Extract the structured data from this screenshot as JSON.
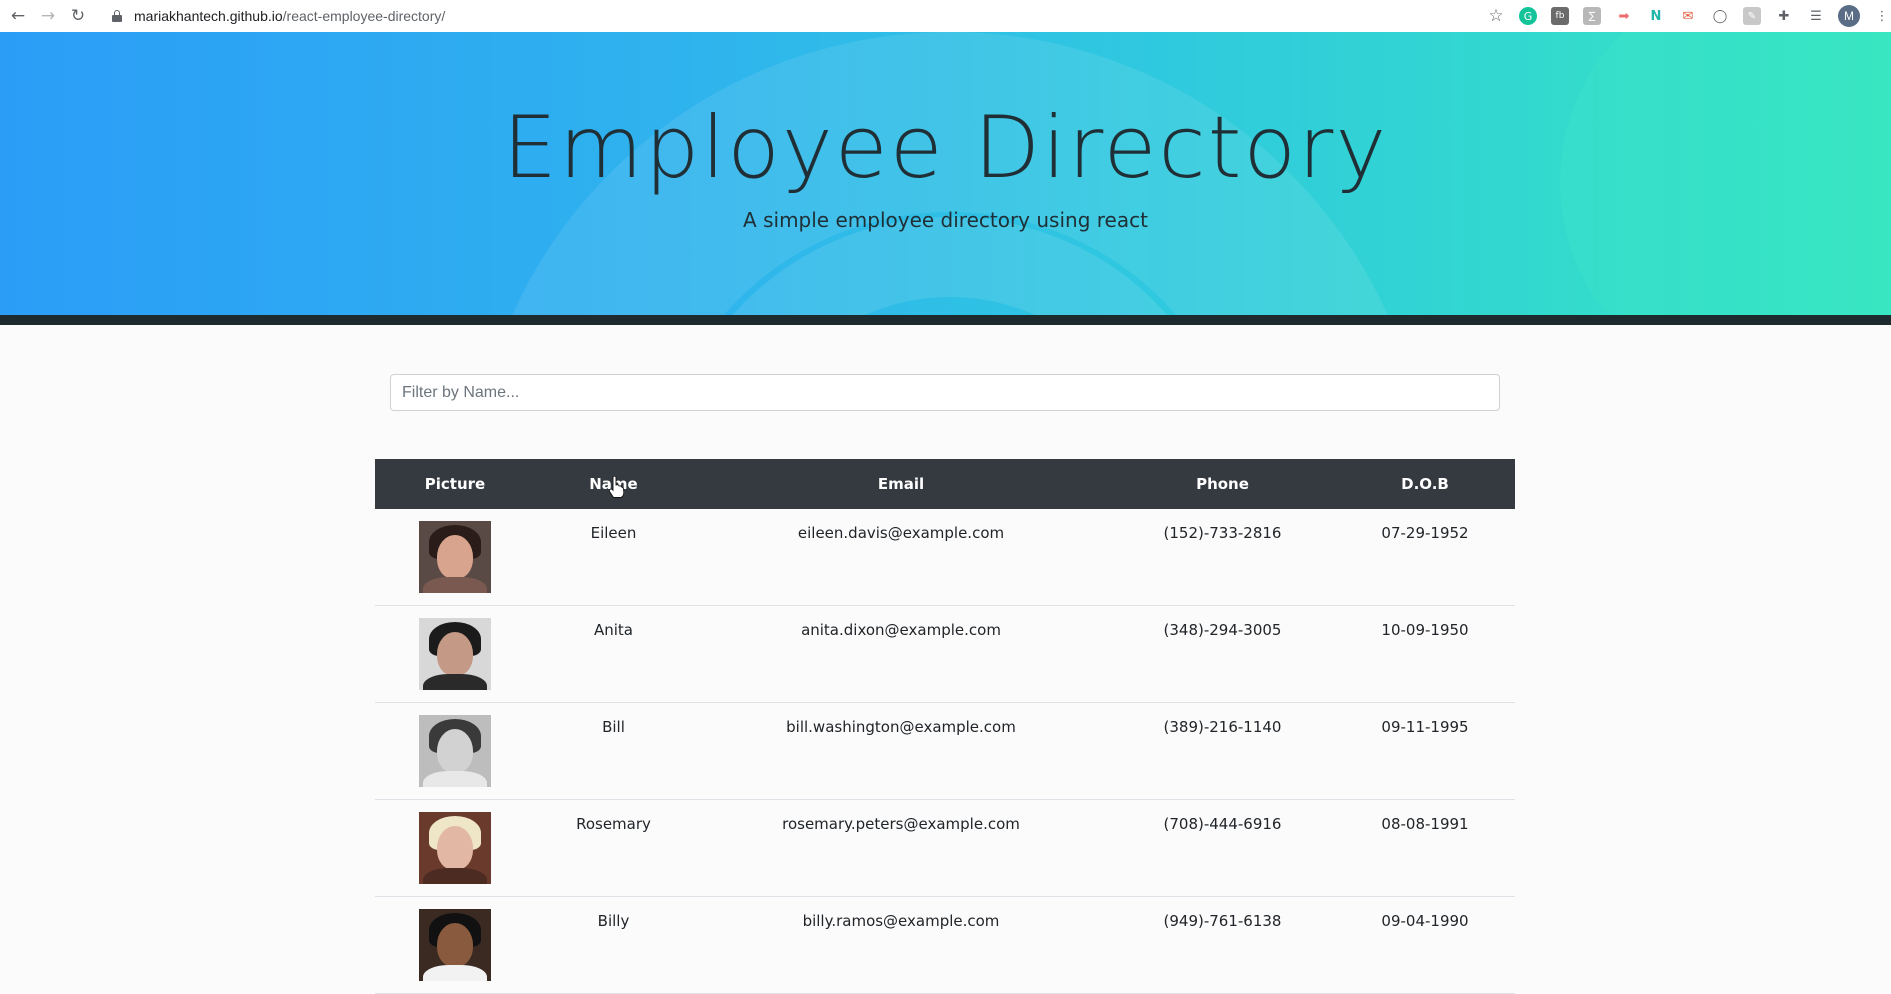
{
  "browser": {
    "url_host": "mariakhantech.github.io",
    "url_path": "/react-employee-directory/",
    "profile_initial": "M"
  },
  "hero": {
    "title": "Employee Directory",
    "subtitle": "A simple employee directory using react"
  },
  "search": {
    "placeholder": "Filter by Name..."
  },
  "table": {
    "headers": [
      "Picture",
      "Name",
      "Email",
      "Phone",
      "D.O.B"
    ],
    "rows": [
      {
        "name": "Eileen",
        "email": "eileen.davis@example.com",
        "phone": "(152)-733-2816",
        "dob": "07-29-1952",
        "photo": {
          "bg": "#5a4a45",
          "hair": "#2a1c18",
          "face": "#d9a48e",
          "shoulders": "#7a5a50"
        }
      },
      {
        "name": "Anita",
        "email": "anita.dixon@example.com",
        "phone": "(348)-294-3005",
        "dob": "10-09-1950",
        "photo": {
          "bg": "#d8d8d8",
          "hair": "#1b1b1b",
          "face": "#c49a86",
          "shoulders": "#2a2a2a"
        }
      },
      {
        "name": "Bill",
        "email": "bill.washington@example.com",
        "phone": "(389)-216-1140",
        "dob": "09-11-1995",
        "photo": {
          "bg": "#bdbdbd",
          "hair": "#3a3a3a",
          "face": "#d2d2d2",
          "shoulders": "#e8e8e8"
        }
      },
      {
        "name": "Rosemary",
        "email": "rosemary.peters@example.com",
        "phone": "(708)-444-6916",
        "dob": "08-08-1991",
        "photo": {
          "bg": "#6a3a2c",
          "hair": "#efe6c8",
          "face": "#e2b8a4",
          "shoulders": "#4b2b22"
        }
      },
      {
        "name": "Billy",
        "email": "billy.ramos@example.com",
        "phone": "(949)-761-6138",
        "dob": "09-04-1990",
        "photo": {
          "bg": "#3b2a22",
          "hair": "#111111",
          "face": "#8a5a3e",
          "shoulders": "#f2f2f2"
        }
      }
    ]
  }
}
